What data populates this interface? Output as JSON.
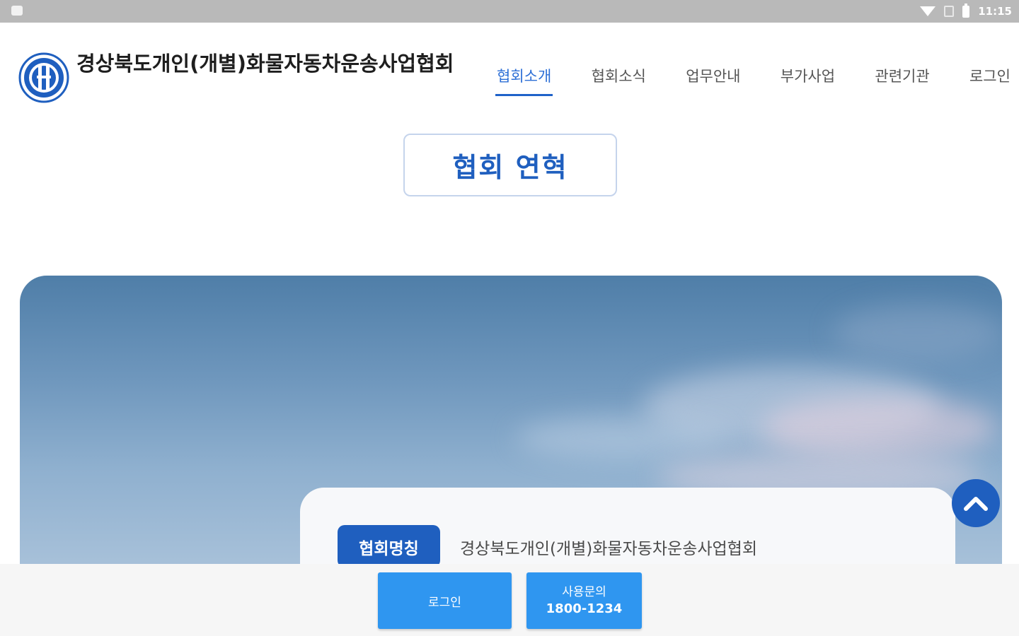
{
  "status_bar": {
    "time": "11:15"
  },
  "header": {
    "title": "경상북도개인(개별)화물자동차운송사업협회",
    "nav": [
      {
        "label": "협회소개",
        "active": true
      },
      {
        "label": "협회소식"
      },
      {
        "label": "업무안내"
      },
      {
        "label": "부가사업"
      },
      {
        "label": "관련기관"
      },
      {
        "label": "로그인"
      }
    ]
  },
  "section": {
    "title": "협회 연혁"
  },
  "info": {
    "label": "협회명칭",
    "value": "경상북도개인(개별)화물자동차운송사업협회"
  },
  "bottom": {
    "login_label": "로그인",
    "support_label": "사용문의",
    "support_phone": "1800-1234"
  },
  "colors": {
    "accent": "#1f5fbf",
    "button": "#2f96f0"
  }
}
